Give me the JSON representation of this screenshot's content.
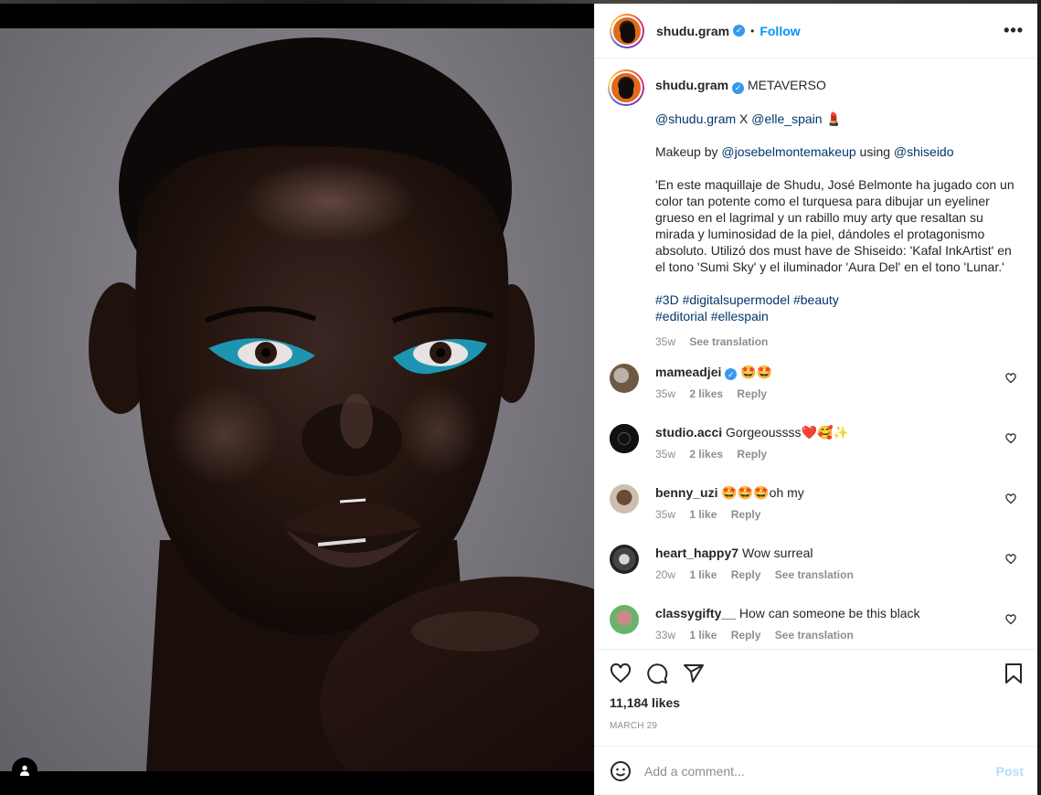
{
  "header": {
    "username": "shudu.gram",
    "follow_label": "Follow",
    "dot": "•",
    "more": "•••"
  },
  "caption": {
    "username": "shudu.gram",
    "title": "METAVERSO",
    "line1_m1": "@shudu.gram",
    "line1_x": " X ",
    "line1_m2": "@elle_spain",
    "line1_emoji": "💄",
    "line2_pre": "Makeup by ",
    "line2_m1": "@josebelmontemakeup",
    "line2_mid": " using ",
    "line2_m2": "@shiseido",
    "body": "'En este maquillaje de Shudu, José Belmonte ha jugado con un color tan potente como el turquesa para dibujar un eyeliner grueso en el lagrimal y un rabillo muy arty que resaltan su mirada y luminosidad de la piel, dándoles el protagonismo absoluto. Utilizó dos must have de Shiseido: 'Kafal InkArtist' en el tono 'Sumi Sky' y el iluminador 'Aura Del' en el tono 'Lunar.'",
    "hashtags_line1": "#3D #digitalsupermodel #beauty",
    "hashtags_line2": "#editorial #ellespain",
    "time": "35w",
    "see_translation": "See translation"
  },
  "comments": [
    {
      "user": "mameadjei",
      "text": "🤩🤩",
      "time": "35w",
      "likes": "2 likes",
      "reply": "Reply",
      "translation": ""
    },
    {
      "user": "studio.acci",
      "text": "Gorgeoussss❤️🥰✨",
      "time": "35w",
      "likes": "2 likes",
      "reply": "Reply",
      "translation": ""
    },
    {
      "user": "benny_uzi",
      "text": "🤩🤩🤩oh my",
      "time": "35w",
      "likes": "1 like",
      "reply": "Reply",
      "translation": ""
    },
    {
      "user": "heart_happy7",
      "text": "Wow surreal",
      "time": "20w",
      "likes": "1 like",
      "reply": "Reply",
      "translation": "See translation"
    },
    {
      "user": "classygifty__",
      "text": "How can someone be this black",
      "time": "33w",
      "likes": "1 like",
      "reply": "Reply",
      "translation": "See translation"
    }
  ],
  "actions": {
    "likes": "11,184 likes",
    "date": "MARCH 29"
  },
  "add_comment": {
    "placeholder": "Add a comment...",
    "post_label": "Post"
  },
  "icons": {
    "like": "heart-icon",
    "comment": "comment-icon",
    "share": "share-icon",
    "save": "bookmark-icon",
    "emoji": "emoji-icon",
    "tag": "user-tag-icon"
  },
  "colors": {
    "link": "#0095f6",
    "mention": "#00376b",
    "muted": "#8e8e8e",
    "verified": "#3897f0",
    "eyeliner": "#1e95b0"
  }
}
